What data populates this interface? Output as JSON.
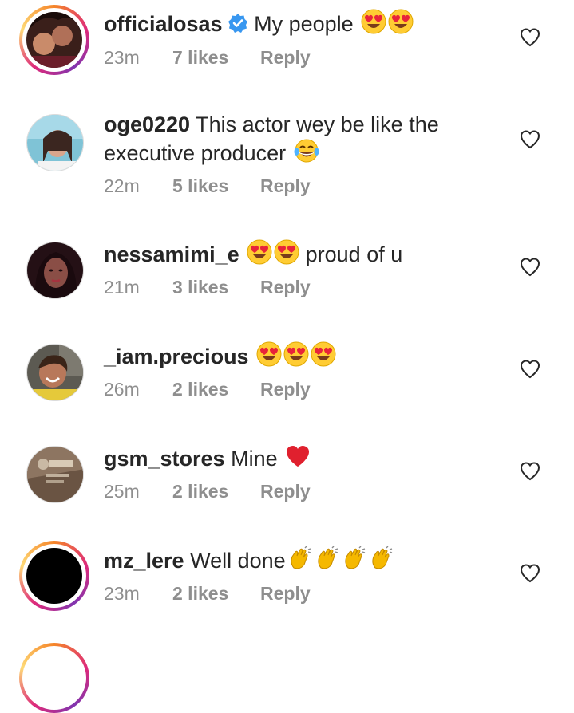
{
  "comments": [
    {
      "username": "officialosas",
      "verified": true,
      "text": "My people",
      "emoji": [
        "heart-eyes",
        "heart-eyes"
      ],
      "time": "23m",
      "likes": "7 likes",
      "reply": "Reply",
      "ringed": true
    },
    {
      "username": "oge0220",
      "verified": false,
      "text": "This actor wey be like the executive producer",
      "emoji": [
        "tears-of-joy"
      ],
      "time": "22m",
      "likes": "5 likes",
      "reply": "Reply",
      "ringed": false
    },
    {
      "username": "nessamimi_e",
      "verified": false,
      "text": "proud of u",
      "emoji": [
        "heart-eyes",
        "heart-eyes"
      ],
      "time": "21m",
      "likes": "3 likes",
      "reply": "Reply",
      "ringed": false
    },
    {
      "username": "_iam.precious",
      "verified": false,
      "text": "",
      "emoji": [
        "heart-eyes",
        "heart-eyes",
        "heart-eyes"
      ],
      "time": "26m",
      "likes": "2 likes",
      "reply": "Reply",
      "ringed": false
    },
    {
      "username": "gsm_stores",
      "verified": false,
      "text": "Mine",
      "emoji": [
        "red-heart"
      ],
      "time": "25m",
      "likes": "2 likes",
      "reply": "Reply",
      "ringed": false
    },
    {
      "username": "mz_lere",
      "verified": false,
      "text": "Well done",
      "emoji": [
        "clapping-hands",
        "clapping-hands",
        "clapping-hands",
        "clapping-hands"
      ],
      "time": "23m",
      "likes": "2 likes",
      "reply": "Reply",
      "ringed": true
    }
  ],
  "colors": {
    "text": "#262626",
    "meta": "#8e8e8e",
    "verified": "#3897f0",
    "heart_red": "#ed4956"
  }
}
